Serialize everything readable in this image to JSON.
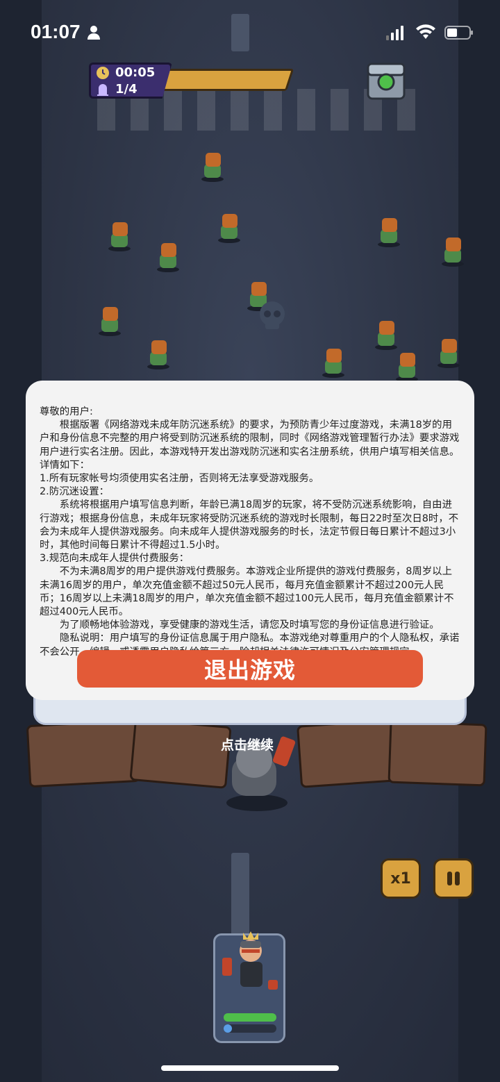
{
  "status_bar": {
    "time": "01:07"
  },
  "hud": {
    "timer": "00:05",
    "wave": "1/4"
  },
  "notice": {
    "greeting": "尊敬的用户:",
    "paragraphs": [
      "根据版署《网络游戏未成年防沉迷系统》的要求，为预防青少年过度游戏，未满18岁的用户和身份信息不完整的用户将受到防沉迷系统的限制，同时《网络游戏管理暂行办法》要求游戏用户进行实名注册。因此，本游戏特开发出游戏防沉迷和实名注册系统，供用户填写相关信息。详情如下：",
      "1.所有玩家帐号均须使用实名注册，否则将无法享受游戏服务。",
      "2.防沉迷设置：",
      "系统将根据用户填写信息判断，年龄已满18周岁的玩家，将不受防沉迷系统影响，自由进行游戏；根据身份信息，未成年玩家将受防沉迷系统的游戏时长限制，每日22时至次日8时，不会为未成年人提供游戏服务。向未成年人提供游戏服务的时长，法定节假日每日累计不超过3小时，其他时间每日累计不得超过1.5小时。",
      "3.规范向未成年人提供付费服务：",
      "不为未满8周岁的用户提供游戏付费服务。本游戏企业所提供的游戏付费服务，8周岁以上未满16周岁的用户，单次充值金额不超过50元人民币，每月充值金额累计不超过200元人民币；16周岁以上未满18周岁的用户，单次充值金额不超过100元人民币，每月充值金额累计不超过400元人民币。",
      "为了顺畅地体验游戏，享受健康的游戏生活，请您及时填写您的身份证信息进行验证。",
      "隐私说明：用户填写的身份证信息属于用户隐私。本游戏绝对尊重用户的个人隐私权，承诺不会公开、编辑、或透露用户隐私给第三方，除却相关法律许可情况及公安管理规定。"
    ],
    "exit_button": "退出游戏"
  },
  "continue_label": "点击继续",
  "controls": {
    "speed_label": "x1"
  },
  "hero": {
    "hp_level": 1.0,
    "xp_level": 0.15
  },
  "colors": {
    "accent_button": "#e35a37",
    "hud_gold": "#d9a23f",
    "hud_purple": "#3b2e6e"
  }
}
